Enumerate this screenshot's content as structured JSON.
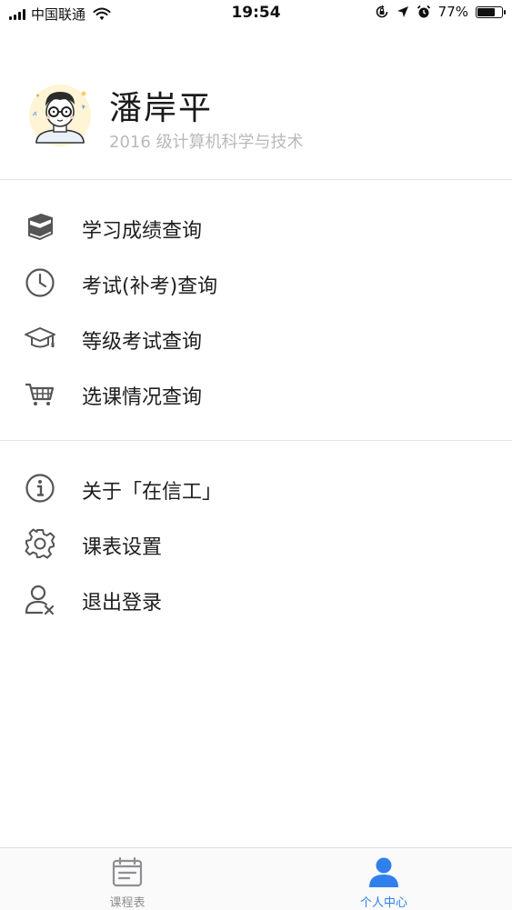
{
  "status_bar": {
    "carrier": "中国联通",
    "time": "19:54",
    "battery_percent": "77%",
    "battery_level": 0.77,
    "icons": [
      "signal-icon",
      "wifi-icon",
      "rotation-lock-icon",
      "location-icon",
      "alarm-icon",
      "battery-icon"
    ]
  },
  "profile": {
    "name": "潘岸平",
    "subtitle": "2016 级计算机科学与技术",
    "avatar_icon": "cartoon-avatar"
  },
  "menu_group_1": [
    {
      "label": "学习成绩查询",
      "icon": "books-icon"
    },
    {
      "label": "考试(补考)查询",
      "icon": "clock-icon"
    },
    {
      "label": "等级考试查询",
      "icon": "graduation-cap-icon"
    },
    {
      "label": "选课情况查询",
      "icon": "cart-icon"
    }
  ],
  "menu_group_2": [
    {
      "label": "关于「在信工」",
      "icon": "info-icon"
    },
    {
      "label": "课表设置",
      "icon": "gear-icon"
    },
    {
      "label": "退出登录",
      "icon": "user-logout-icon"
    }
  ],
  "tab_bar": {
    "tabs": [
      {
        "label": "课程表",
        "icon": "calendar-icon",
        "active": false
      },
      {
        "label": "个人中心",
        "icon": "person-icon",
        "active": true
      }
    ]
  },
  "colors": {
    "accent": "#2f80ed",
    "inactive_tab": "#8e8e93",
    "icon_gray": "#555555",
    "divider": "#e3e3e3"
  }
}
